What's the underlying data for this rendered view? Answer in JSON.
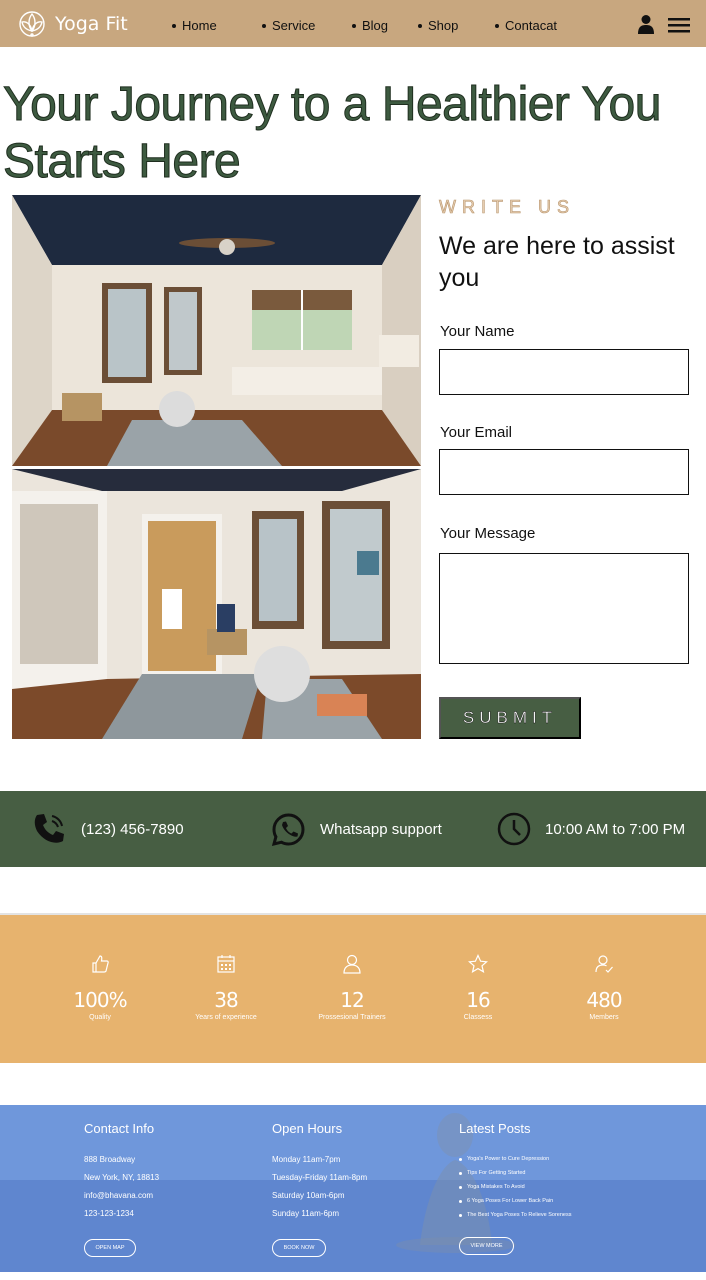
{
  "nav": {
    "brand": "Yoga Fit",
    "links": [
      "Home",
      "Service",
      "Blog",
      "Shop",
      "Contacat"
    ],
    "icons": [
      "lotus-logo",
      "user-icon",
      "menu-icon"
    ]
  },
  "hero": {
    "title_line1": "Your Journey to a Healthier You",
    "title_line2": "Starts Here"
  },
  "form": {
    "eyebrow": "WRITE US",
    "heading": "We are here to assist you",
    "name_label": "Your Name",
    "name_value": "",
    "email_label": "Your Email",
    "email_value": "",
    "message_label": "Your Message",
    "message_value": "",
    "submit_label": "SUBMIT"
  },
  "contact_bar": {
    "phone": "(123) 456-7890",
    "whatsapp": "Whatsapp support",
    "hours": "10:00 AM to 7:00 PM"
  },
  "stats": [
    {
      "icon": "thumbs-up-icon",
      "value": "100%",
      "caption": "Quality"
    },
    {
      "icon": "calendar-icon",
      "value": "38",
      "caption": "Years of experience"
    },
    {
      "icon": "user-icon",
      "value": "12",
      "caption": "Prossesional Trainers"
    },
    {
      "icon": "star-icon",
      "value": "16",
      "caption": "Classess"
    },
    {
      "icon": "members-icon",
      "value": "480",
      "caption": "Members"
    }
  ],
  "footer": {
    "contact": {
      "heading": "Contact Info",
      "lines": [
        "888 Broadway",
        "New York, NY, 18813",
        "info@bhavana.com",
        "123-123-1234"
      ],
      "button": "OPEN MAP"
    },
    "hours": {
      "heading": "Open Hours",
      "lines": [
        "Monday 11am-7pm",
        "Tuesday-Friday 11am-8pm",
        "Saturday 10am-6pm",
        "Sunday 11am-6pm"
      ],
      "button": "BOOK NOW"
    },
    "posts": {
      "heading": "Latest Posts",
      "items": [
        "Yoga's Power to Cure Depression",
        "Tips For Getting Started",
        "Yoga Mistakes To Avoid",
        "6 Yoga Poses For Lower Back Pain",
        "The Best Yoga Poses To Relieve Soreness"
      ],
      "button": "VIEW MORE"
    }
  },
  "colors": {
    "nav_bg": "#c8a77f",
    "title_green": "#3d5a40",
    "dark_green": "#475e43",
    "stats_bg": "#e7b36e",
    "footer_bg": "#6890d6"
  }
}
